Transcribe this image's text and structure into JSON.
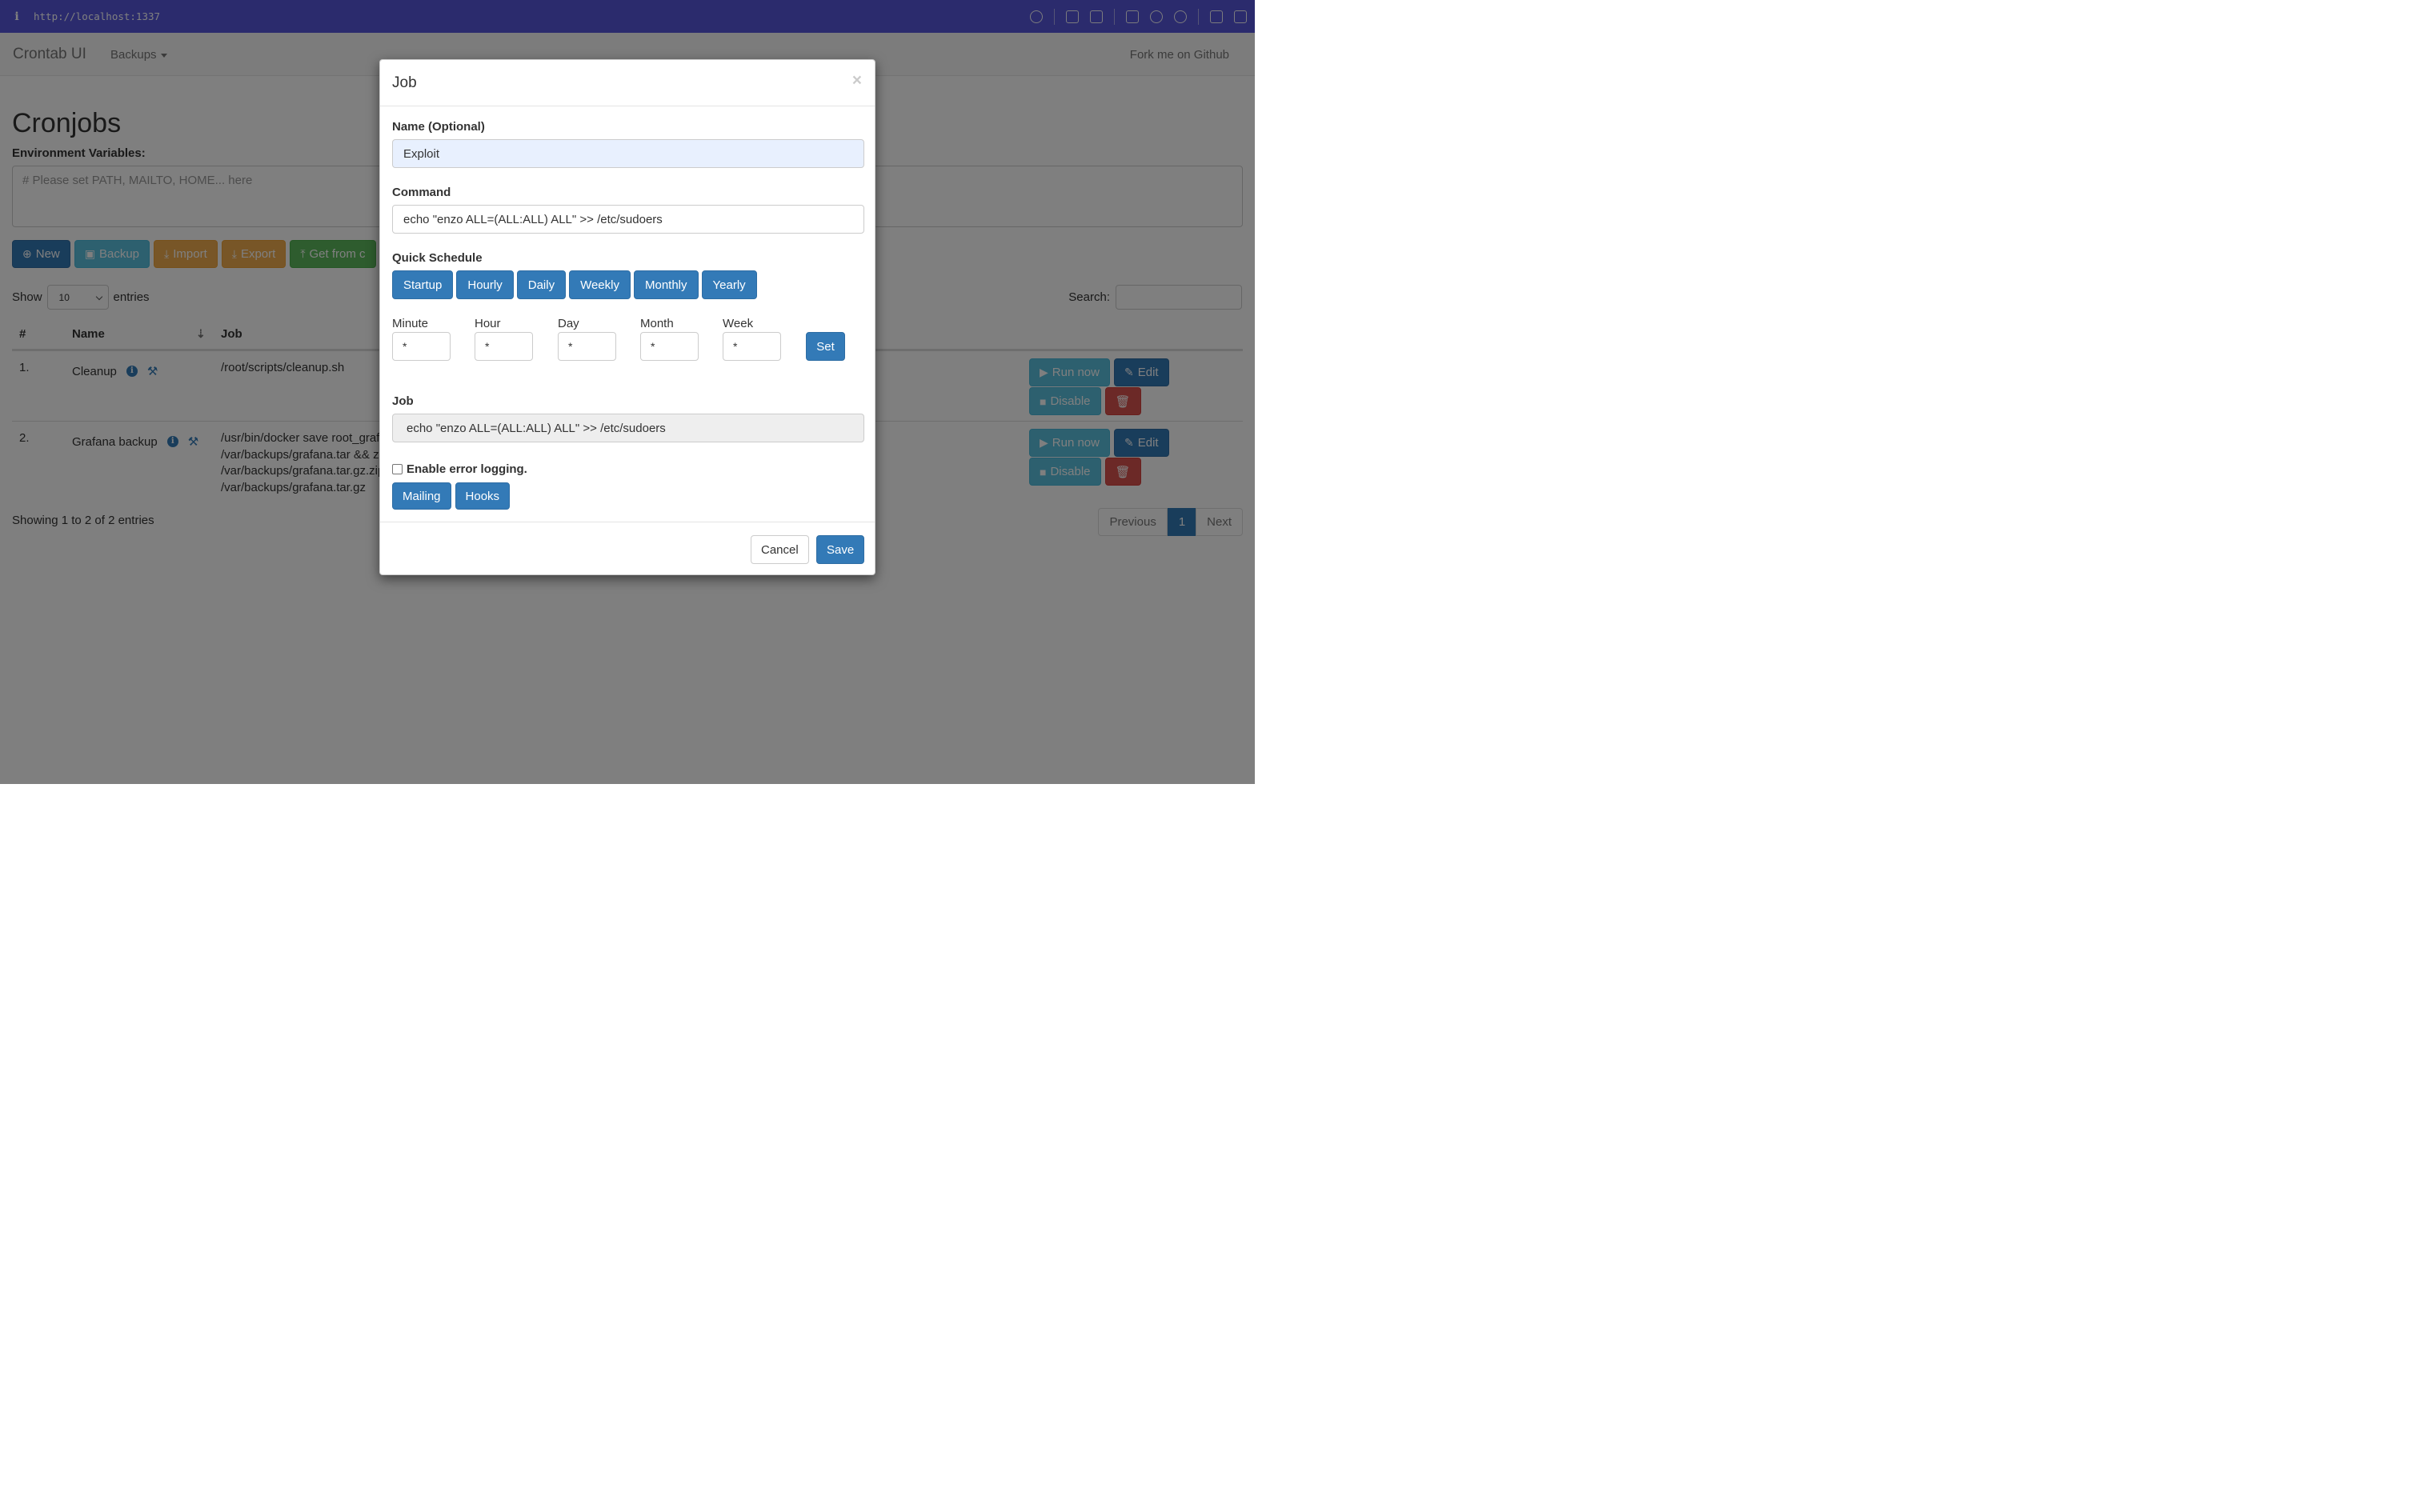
{
  "browser": {
    "info_glyph": "i",
    "url": "http://localhost:1337"
  },
  "navbar": {
    "brand": "Crontab UI",
    "backups": "Backups",
    "fork": "Fork me on Github"
  },
  "page": {
    "title": "Cronjobs",
    "env_label": "Environment Variables:",
    "env_placeholder": "# Please set PATH, MAILTO, HOME... here",
    "toolbar": {
      "new": "New",
      "backup": "Backup",
      "import": "Import",
      "export": "Export",
      "get_from": "Get from c"
    },
    "show": "Show",
    "entries_value": "10",
    "entries": "entries",
    "search_label": "Search:",
    "table": {
      "headers": {
        "num": "#",
        "name": "Name",
        "job": "Job"
      },
      "rows": [
        {
          "num": "1.",
          "name": "Cleanup",
          "cmd": [
            "/root/scripts/cleanup.sh"
          ]
        },
        {
          "num": "2.",
          "name": "Grafana backup",
          "cmd": [
            "/usr/bin/docker save root_grafa",
            "/var/backups/grafana.tar && zi",
            "/var/backups/grafana.tar.gz.zip",
            "/var/backups/grafana.tar.gz"
          ]
        }
      ],
      "actions": {
        "run_now": "Run now",
        "edit": "Edit",
        "disable": "Disable"
      }
    },
    "info": "Showing 1 to 2 of 2 entries",
    "pagination": {
      "prev": "Previous",
      "page": "1",
      "next": "Next"
    }
  },
  "modal": {
    "title": "Job",
    "close": "×",
    "name_label": "Name (Optional)",
    "name_value": "Exploit",
    "command_label": "Command",
    "command_value": "echo \"enzo ALL=(ALL:ALL) ALL\" >> /etc/sudoers",
    "quick_label": "Quick Schedule",
    "quick": [
      "Startup",
      "Hourly",
      "Daily",
      "Weekly",
      "Monthly",
      "Yearly"
    ],
    "schedule": {
      "minute_label": "Minute",
      "minute": "*",
      "hour_label": "Hour",
      "hour": "*",
      "day_label": "Day",
      "day": "*",
      "month_label": "Month",
      "month": "*",
      "week_label": "Week",
      "week": "*"
    },
    "set": "Set",
    "job_label": "Job",
    "job_value": "echo \"enzo ALL=(ALL:ALL) ALL\" >> /etc/sudoers",
    "error_logging": "Enable error logging.",
    "mailing": "Mailing",
    "hooks": "Hooks",
    "cancel": "Cancel",
    "save": "Save"
  },
  "colors": {
    "primary": "#337ab7",
    "info": "#5bc0de",
    "warning": "#f0ad4e",
    "success": "#5cb85c",
    "danger": "#d9534f",
    "browser_bar": "#5656db"
  }
}
